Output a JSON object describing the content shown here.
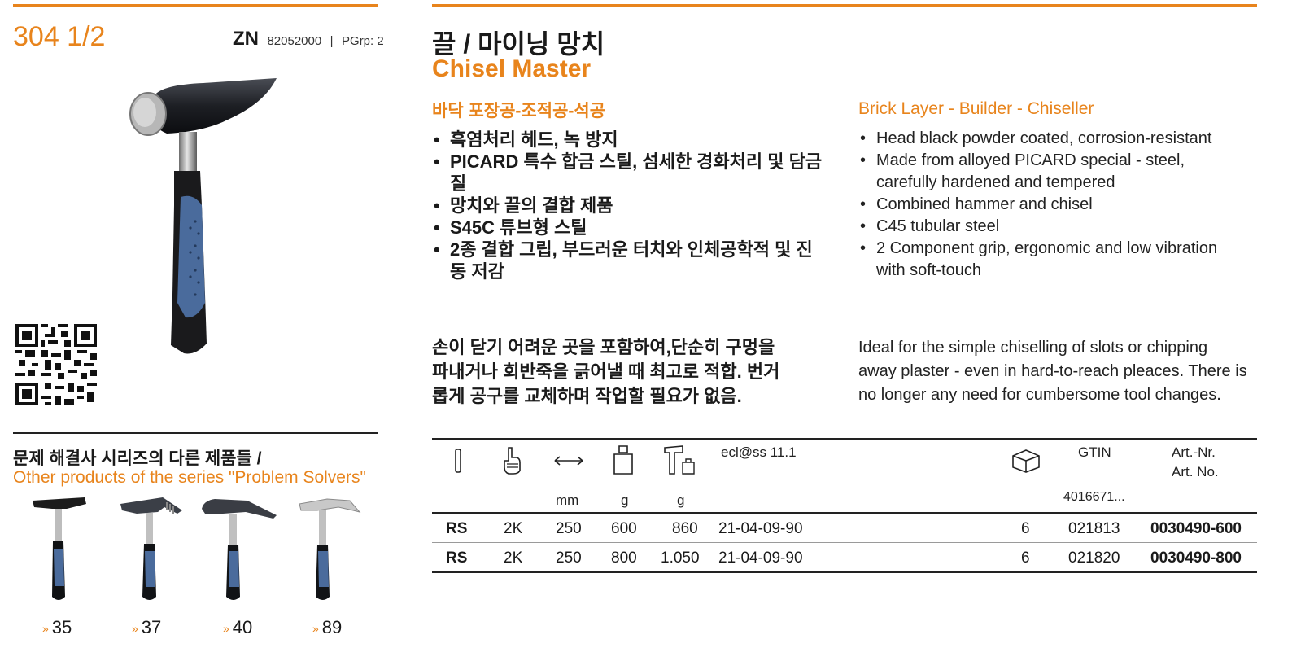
{
  "header": {
    "model": "304 1/2",
    "zn_label": "ZN",
    "zn_number": "82052000",
    "separator": "|",
    "pgrp": "PGrp: 2"
  },
  "title": {
    "ko": "끌 / 마이닝 망치",
    "en": "Chisel Master"
  },
  "trades": {
    "ko": "바닥 포장공-조적공-석공",
    "en": "Brick Layer - Builder - Chiseller"
  },
  "features_ko": [
    "흑염처리 헤드, 녹 방지",
    "PICARD 특수 합금 스틸, 섬세한 경화처리 및 담금질",
    "망치와 끌의 결합 제품",
    "S45C 튜브형 스틸",
    "2종 결합 그립, 부드러운 터치와 인체공학적 및 진동 저감"
  ],
  "features_en": [
    "Head black powder coated, corrosion-resistant",
    "Made from alloyed PICARD special - steel, carefully hardened and tempered",
    "Combined hammer and chisel",
    "C45 tubular steel",
    "2 Component grip, ergonomic and low vibration with soft-touch"
  ],
  "description": {
    "ko": "손이 닫기 어려운 곳을 포함하여,단순히 구멍을 파내거나 회반죽을 긁어낼 때 최고로 적합. 번거롭게 공구를 교체하며 작업할 필요가 없음.",
    "en": "Ideal for the simple chiselling of slots or chipping away plaster - even in hard-to-reach pleaces. There is no longer any need for cumbersome tool changes."
  },
  "series": {
    "ko": "문제 해결사 시리즈의 다른 제품들 /",
    "en": "Other products of the series \"Problem Solvers\"",
    "refs": [
      {
        "mark": "»",
        "page": "35"
      },
      {
        "mark": "»",
        "page": "37"
      },
      {
        "mark": "»",
        "page": "40"
      },
      {
        "mark": "»",
        "page": "89"
      }
    ]
  },
  "table": {
    "headers": {
      "eclass": "ecl@ss 11.1",
      "gtin": "GTIN",
      "art_de": "Art.-Nr.",
      "art_en": "Art. No."
    },
    "units": {
      "length": "mm",
      "weight": "g",
      "total": "g",
      "gtin_prefix": "4016671..."
    },
    "rows": [
      {
        "head": "RS",
        "grip": "2K",
        "length": "250",
        "weight": "600",
        "total": "860",
        "eclass": "21-04-09-90",
        "pack": "6",
        "gtin": "021813",
        "art": "0030490-600"
      },
      {
        "head": "RS",
        "grip": "2K",
        "length": "250",
        "weight": "800",
        "total": "1.050",
        "eclass": "21-04-09-90",
        "pack": "6",
        "gtin": "021820",
        "art": "0030490-800"
      }
    ]
  },
  "colors": {
    "accent": "#e8841c",
    "grip_blue": "#4a6b9c",
    "text": "#1a1a1a"
  },
  "icons": [
    "handle-icon",
    "grip-icon",
    "length-arrow-icon",
    "weight-icon",
    "hammer-weight-icon",
    "package-box-icon",
    "qr-code-icon"
  ]
}
